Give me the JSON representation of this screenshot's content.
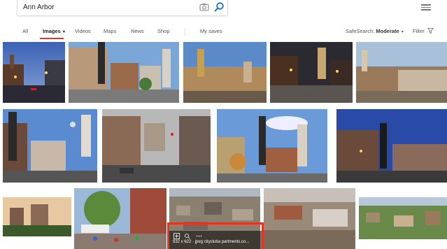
{
  "search": {
    "query": "Ann Arbor"
  },
  "icons": {
    "camera": "camera-icon",
    "search": "magnifier-icon",
    "menu": "hamburger-menu-icon",
    "filter": "funnel-icon"
  },
  "tabs": [
    {
      "label": "All"
    },
    {
      "label": "Images"
    },
    {
      "label": "Videos"
    },
    {
      "label": "Maps"
    },
    {
      "label": "News"
    },
    {
      "label": "Shop"
    },
    {
      "label": "My saves"
    }
  ],
  "safesearch": {
    "label": "SafeSearch:",
    "value": "Moderate"
  },
  "filter": {
    "label": "Filter"
  },
  "accent_color": "#d23c2e",
  "highlight_color": "#e8341c",
  "image_meta": {
    "dimensions": "932 x 622 · jpeg",
    "source": "citycluba partments.co..."
  }
}
